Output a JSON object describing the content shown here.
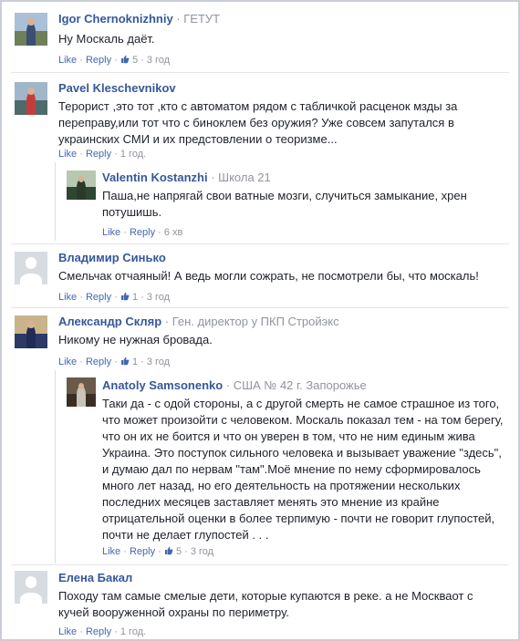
{
  "labels": {
    "like": "Like",
    "reply": "Reply",
    "dot": "·"
  },
  "comments": [
    {
      "name": "Igor Chernoknizhniy",
      "meta": "ГЕТУТ",
      "text": "Ну Москаль даёт.",
      "likes": "5",
      "time": "3 год"
    },
    {
      "name": "Pavel Kleschevnikov",
      "meta": "",
      "text": "Терорист ,это тот ,кто с автоматом рядом с табличкой расценок мзды за переправу,или тот что с биноклем без оружия? Уже совсем запутался в украинских СМИ и их предстовлении о теоризме...",
      "likes": "",
      "time": "1 год."
    },
    {
      "name": "Valentin Kostanzhi",
      "meta": "Школа 21",
      "text": "Паша,не напрягай свои ватные мозги, случиться замыкание, хрен потушишь.",
      "likes": "",
      "time": "6 хв"
    },
    {
      "name": "Владимир Синько",
      "meta": "",
      "text": "Смельчак отчаяный! А ведь могли сожрать, не посмотрели бы, что москаль!",
      "likes": "1",
      "time": "3 год"
    },
    {
      "name": "Александр Скляр",
      "meta": "Ген. директор у ПКП Стройэкс",
      "text": "Никому не нужная бровада.",
      "likes": "1",
      "time": "3 год"
    },
    {
      "name": "Anatoly Samsonenko",
      "meta": "США № 42 г. Запорожье",
      "text": "Таки да - с одой стороны, а с другой смерть не самое страшное из того, что может произойти с человеком. Москаль показал тем - на том берегу, что он их не боится и что он уверен в том, что не ним единым жива Украина. Это поступок сильного человека и вызывает уважение \"здесь\", и думаю дал по нервам \"там\".Моё мнение по нему сформировалось много лет назад, но его деятельность на протяжении нескольких последних месяцев заставляет менять это мнение из крайне отрицательной оценки в более терпимую - почти не говорит глупостей, почти не делает глупостей . . .",
      "likes": "5",
      "time": "3 год"
    },
    {
      "name": "Елена Бакал",
      "meta": "",
      "text": "Походу там самые смелые дети, которые купаются в реке. а не Москваот с кучей вооруженной охраны по периметру.",
      "likes": "",
      "time": "1 год."
    }
  ]
}
